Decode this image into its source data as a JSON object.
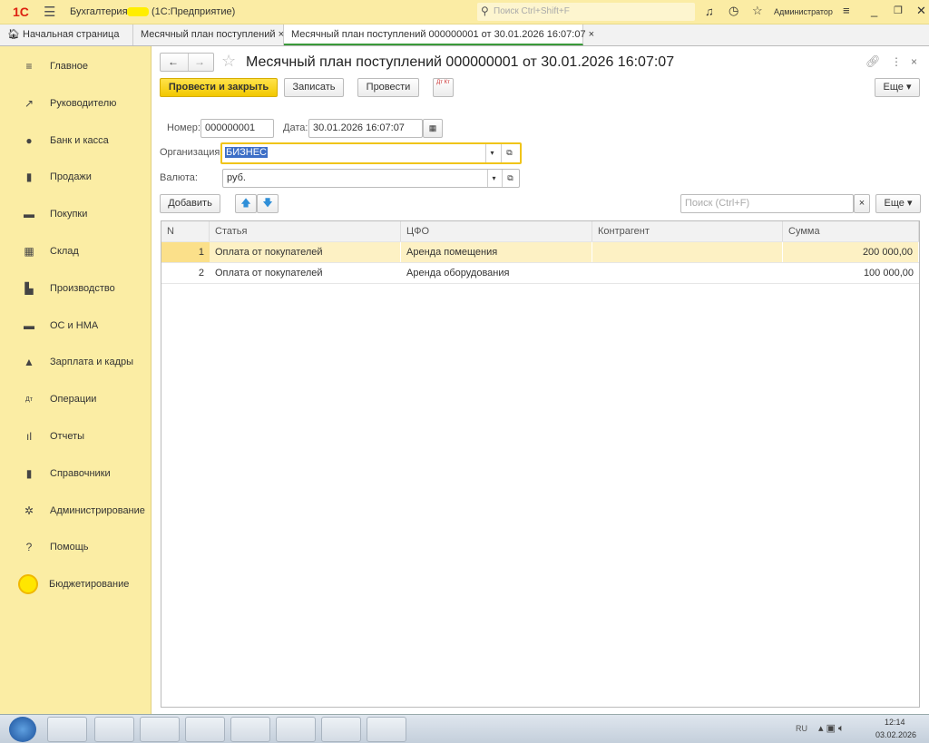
{
  "topbar": {
    "logo": "1С",
    "app_title": "Бухгалтерия",
    "platform": "(1С:Предприятие)",
    "search_placeholder": "Поиск Ctrl+Shift+F",
    "user": "Администратор"
  },
  "tabs": [
    {
      "label": "Начальная страница"
    },
    {
      "label": "Месячный план поступлений"
    },
    {
      "label": "Месячный план поступлений 000000001 от 30.01.2026 16:07:07"
    }
  ],
  "sidebar": {
    "items": [
      {
        "label": "Главное",
        "icon": "≡"
      },
      {
        "label": "Руководителю",
        "icon": "↗"
      },
      {
        "label": "Банк и касса",
        "icon": "●"
      },
      {
        "label": "Продажи",
        "icon": "▮"
      },
      {
        "label": "Покупки",
        "icon": "▬"
      },
      {
        "label": "Склад",
        "icon": "▦"
      },
      {
        "label": "Производство",
        "icon": "▙"
      },
      {
        "label": "ОС и НМА",
        "icon": "▬"
      },
      {
        "label": "Зарплата и кадры",
        "icon": "▲"
      },
      {
        "label": "Операции",
        "icon": "Дт"
      },
      {
        "label": "Отчеты",
        "icon": "ıl"
      },
      {
        "label": "Справочники",
        "icon": "▮"
      },
      {
        "label": "Администрирование",
        "icon": "✲"
      },
      {
        "label": "Помощь",
        "icon": "?"
      },
      {
        "label": "Бюджетирование",
        "icon": "●"
      }
    ]
  },
  "document": {
    "title": "Месячный план поступлений 000000001 от 30.01.2026 16:07:07",
    "buttons": {
      "post_close": "Провести и закрыть",
      "save": "Записать",
      "post": "Провести",
      "dtkt": "Дт Кт",
      "more": "Еще ▾"
    },
    "number_label": "Номер:",
    "number": "000000001",
    "date_label": "Дата:",
    "date": "30.01.2026 16:07:07",
    "org_label": "Организация:",
    "org": "БИЗНЕС",
    "currency_label": "Валюта:",
    "currency": "руб."
  },
  "table_toolbar": {
    "add": "Добавить",
    "search_placeholder": "Поиск (Ctrl+F)",
    "clear": "×",
    "more": "Еще ▾"
  },
  "table": {
    "columns": [
      "N",
      "Статья",
      "ЦФО",
      "Контрагент",
      "Сумма"
    ],
    "rows": [
      [
        "1",
        "Оплата от покупателей",
        "Аренда помещения",
        "",
        "200 000,00"
      ],
      [
        "2",
        "Оплата от покупателей",
        "Аренда оборудования",
        "",
        "100 000,00"
      ]
    ]
  },
  "taskbar": {
    "lang": "RU",
    "time": "12:14",
    "date": "03.02.2026"
  }
}
